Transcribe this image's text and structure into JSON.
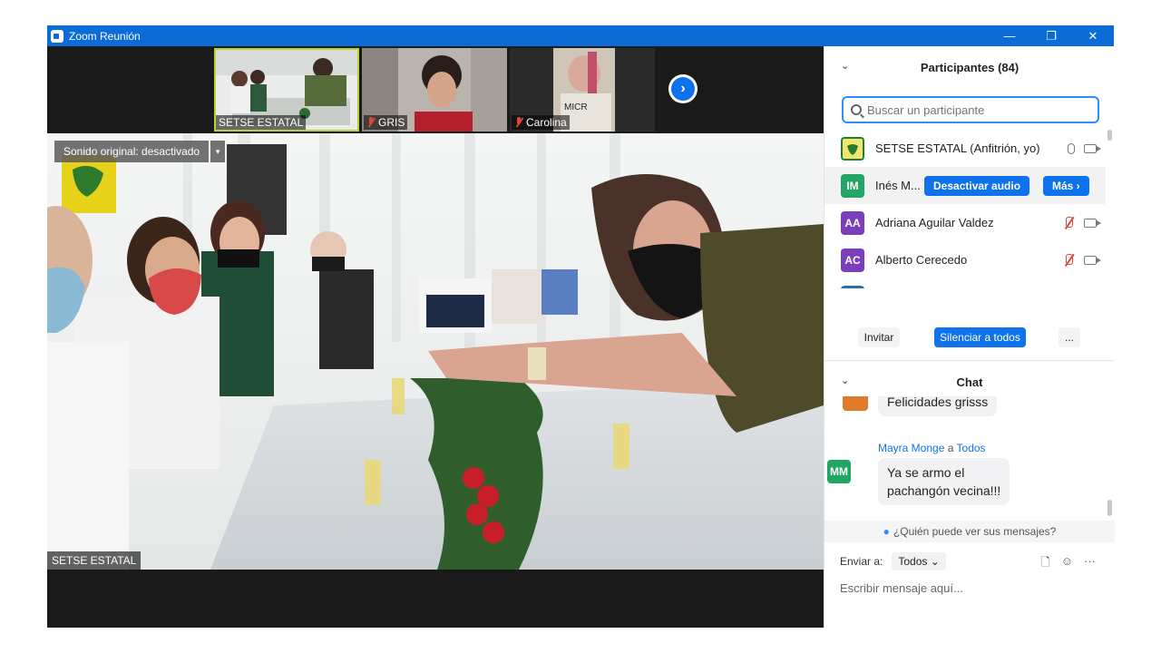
{
  "window": {
    "title": "Zoom Reunión",
    "controls": {
      "minimize": "—",
      "restore": "❐",
      "close": "✕"
    }
  },
  "thumbnails": [
    {
      "name": "SETSE ESTATAL",
      "muted": false
    },
    {
      "name": "GRIS",
      "muted": true
    },
    {
      "name": "Carolina",
      "muted": true
    }
  ],
  "next_page_icon": "›",
  "main_video": {
    "speaker_label": "SETSE ESTATAL",
    "sound_original": "Sonido original: desactivado",
    "dropdown_glyph": "▾"
  },
  "participants": {
    "header": "Participantes (84)",
    "collapse_glyph": "⌄",
    "search_placeholder": "Buscar un participante",
    "list": [
      {
        "initials": "",
        "name": "SETSE ESTATAL (Anfitrión, yo)",
        "color": "#d8c940",
        "mic": "on"
      },
      {
        "initials": "IM",
        "name": "Inés M...",
        "color": "#22a565",
        "mic": "hover"
      },
      {
        "initials": "AA",
        "name": "Adriana Aguilar Valdez",
        "color": "#7b3fbe",
        "mic": "off"
      },
      {
        "initials": "AC",
        "name": "Alberto Cerecedo",
        "color": "#7b3fbe",
        "mic": "off"
      }
    ],
    "hover_actions": {
      "mute": "Desactivar audio",
      "more": "Más ›"
    },
    "buttons": {
      "invite": "Invitar",
      "mute_all": "Silenciar a todos",
      "more": "..."
    }
  },
  "chat": {
    "header": "Chat",
    "messages": [
      {
        "text": "Felicidades grisss"
      },
      {
        "sender": "Mayra Monge",
        "connector": "a",
        "recipient": "Todos",
        "initials": "MM",
        "color": "#22a565",
        "text_line1": "Ya se armo el",
        "text_line2": "pachangón vecina!!!"
      }
    ],
    "who_can_see": "¿Quién puede ver sus mensajes?",
    "send_to_label": "Enviar a:",
    "send_to_value": "Todos",
    "input_placeholder": "Escribir mensaje aquí...",
    "tools": {
      "file": "🗋",
      "emoji": "☺",
      "more": "···"
    }
  }
}
